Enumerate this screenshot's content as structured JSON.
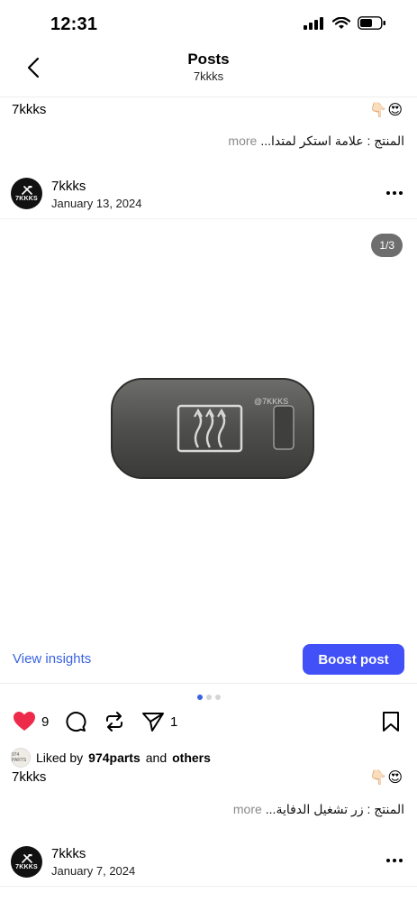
{
  "status_bar": {
    "time": "12:31"
  },
  "nav": {
    "title": "Posts",
    "subtitle": "7kkks"
  },
  "prev_post": {
    "username": "7kkks",
    "emojis": "👇🏻😍",
    "caption": "المنتج : علامة استكر لمتدا...",
    "more": "more"
  },
  "post": {
    "username": "7kkks",
    "date": "January 13, 2024",
    "avatar_text": "7KKKS",
    "media_counter": "1/3",
    "watermark": "@7KKKS",
    "insights_label": "View insights",
    "boost_label": "Boost post",
    "likes": "9",
    "shares": "1",
    "liked_by_prefix": "Liked by",
    "liked_by_user": "974parts",
    "liked_by_and": "and",
    "liked_by_others": "others",
    "caption_username": "7kkks",
    "caption_emojis": "👇🏻😍",
    "caption": "المنتج : زر تشغيل الدفاية...",
    "more": "more",
    "liked_avatar_text": "974 PARTS"
  },
  "next_post": {
    "username": "7kkks",
    "date": "January 7, 2024",
    "avatar_text": "7KKKS"
  },
  "colors": {
    "accent": "#4150f7",
    "link": "#3a63e0",
    "like": "#ee2a4a"
  }
}
